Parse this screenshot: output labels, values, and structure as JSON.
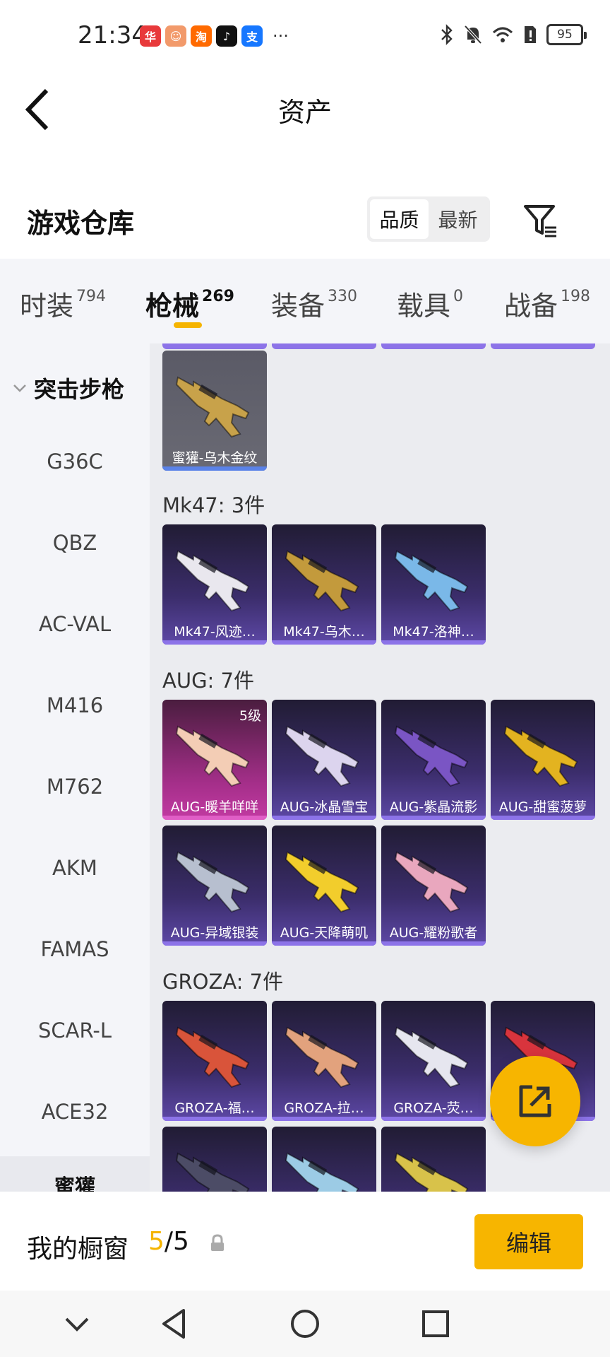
{
  "status_bar": {
    "time": "21:34",
    "apps": [
      {
        "icon": "huawei-app-icon",
        "color": "#e8393b",
        "glyph": "华"
      },
      {
        "icon": "game-avatar-icon",
        "color": "#f29a6b",
        "glyph": "☺"
      },
      {
        "icon": "taobao-icon",
        "color": "#ff6a00",
        "glyph": "淘"
      },
      {
        "icon": "tiktok-icon",
        "color": "#111111",
        "glyph": "♪"
      },
      {
        "icon": "alipay-icon",
        "color": "#1677ff",
        "glyph": "支"
      }
    ],
    "more": "···",
    "battery": "95"
  },
  "header": {
    "title": "资产",
    "section_title": "游戏仓库",
    "sort_options": [
      "品质",
      "最新"
    ],
    "sort_active": 0
  },
  "category_tabs": [
    {
      "label": "时装",
      "count": "794"
    },
    {
      "label": "枪械",
      "count": "269"
    },
    {
      "label": "装备",
      "count": "330"
    },
    {
      "label": "载具",
      "count": "0"
    },
    {
      "label": "战备",
      "count": "198"
    }
  ],
  "active_tab": 1,
  "sidebar": {
    "group": "突击步枪",
    "items": [
      "G36C",
      "QBZ",
      "AC-VAL",
      "M416",
      "M762",
      "AKM",
      "FAMAS",
      "SCAR-L",
      "ACE32",
      "蜜獾"
    ]
  },
  "groups": [
    {
      "title": "",
      "items": [
        {
          "label": "蜜獾-乌木金纹",
          "color": "#c8a24a"
        }
      ]
    },
    {
      "title": "Mk47: 3件",
      "items": [
        {
          "label": "Mk47-风迹…",
          "color": "#e9e7ee"
        },
        {
          "label": "Mk47-乌木…",
          "color": "#c39a3c"
        },
        {
          "label": "Mk47-洛神…",
          "color": "#7ab8e8"
        }
      ]
    },
    {
      "title": "AUG: 7件",
      "items": [
        {
          "label": "AUG-暖羊咩咩",
          "color": "#f3cdb5",
          "level": "5级"
        },
        {
          "label": "AUG-冰晶雪宝",
          "color": "#dcd4ee"
        },
        {
          "label": "AUG-紫晶流影",
          "color": "#7a55c4"
        },
        {
          "label": "AUG-甜蜜菠萝",
          "color": "#e3b320"
        },
        {
          "label": "AUG-异域银装",
          "color": "#b7bfcf"
        },
        {
          "label": "AUG-天降萌叽",
          "color": "#f2cd2c"
        },
        {
          "label": "AUG-耀粉歌者",
          "color": "#e9a7be"
        }
      ]
    },
    {
      "title": "GROZA: 7件",
      "items": [
        {
          "label": "GROZA-福…",
          "color": "#d9543a"
        },
        {
          "label": "GROZA-拉…",
          "color": "#e2a27d"
        },
        {
          "label": "GROZA-荧…",
          "color": "#e6e6ef"
        },
        {
          "label": "",
          "color": "#d8343d"
        },
        {
          "label": "",
          "color": "#4c4c66"
        },
        {
          "label": "",
          "color": "#9ccbe5"
        },
        {
          "label": "",
          "color": "#d8c24a"
        }
      ]
    }
  ],
  "showcase": {
    "label": "我的橱窗",
    "current": "5",
    "total": "/5",
    "edit_label": "编辑"
  }
}
